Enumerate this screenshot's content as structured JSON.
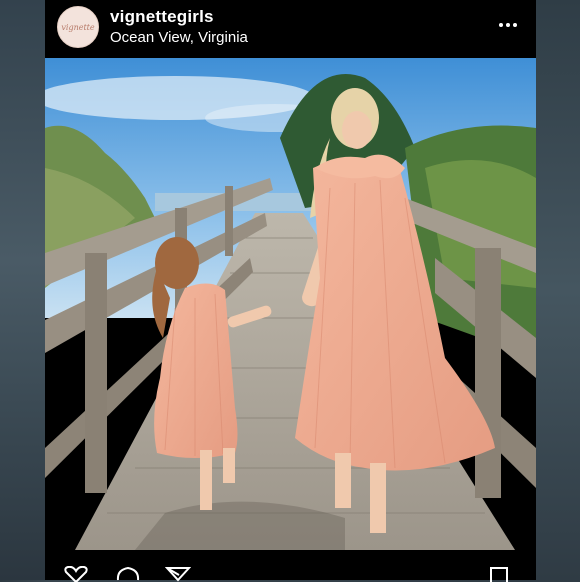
{
  "post": {
    "username": "vignettegirls",
    "location": "Ocean View, Virginia",
    "avatar_text": "vignette"
  },
  "icons": {
    "more": "more-horizontal-icon",
    "like": "heart-icon",
    "comment": "comment-icon",
    "share": "send-icon",
    "save": "bookmark-icon"
  },
  "colors": {
    "frame": "#000000",
    "text": "#ffffff",
    "avatar_bg": "#f3e3dc"
  }
}
